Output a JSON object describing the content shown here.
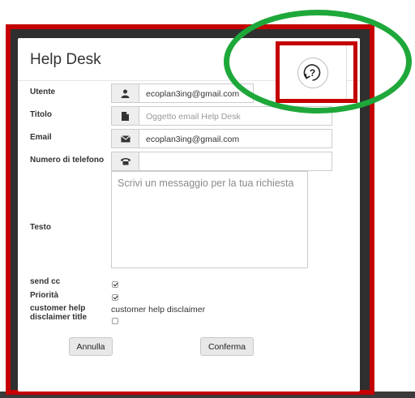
{
  "modal": {
    "title": "Help Desk",
    "fields": {
      "utente": {
        "label": "Utente",
        "value": "ecoplan3ing@gmail.com",
        "icon": "user-icon"
      },
      "titolo": {
        "label": "Titolo",
        "placeholder": "Oggetto email Help Desk",
        "icon": "file-icon"
      },
      "email": {
        "label": "Email",
        "value": "ecoplan3ing@gmail.com",
        "icon": "envelope-icon"
      },
      "telefono": {
        "label": "Numero di telefono",
        "value": "",
        "icon": "phone-icon"
      },
      "testo": {
        "label": "Testo",
        "placeholder": "Scrivi un messaggio per la tua richiesta"
      }
    },
    "send_cc": {
      "label": "send cc",
      "checked": true
    },
    "priorita": {
      "label": "Priorità",
      "checked": true
    },
    "customer_help": {
      "label_line1": "customer help",
      "label_line2": "disclaimer title",
      "text": "customer help disclaimer",
      "checked": false
    },
    "buttons": {
      "cancel": "Annulla",
      "confirm": "Conferma"
    },
    "help_button": {
      "icon": "question-circle-icon",
      "glyph": "?"
    }
  },
  "annotations": {
    "red_highlight": "#c40000",
    "green_highlight": "#1ea83a"
  }
}
